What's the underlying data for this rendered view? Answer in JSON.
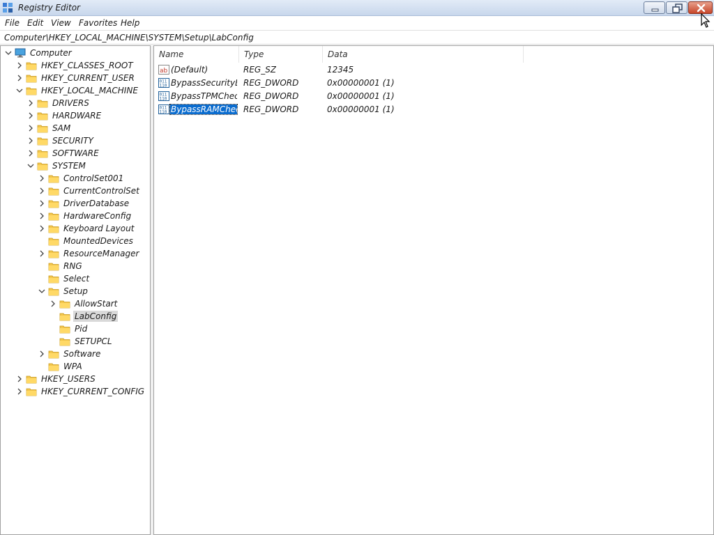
{
  "window": {
    "title": "Registry Editor",
    "app_icon": "registry-editor-icon",
    "controls": [
      "minimize-icon",
      "restore-icon",
      "close-icon"
    ],
    "accent_close": "#c7462a",
    "title_gradient": [
      "#e2ebf7",
      "#c8d7ec"
    ]
  },
  "menu": {
    "items": [
      "File",
      "Edit",
      "View",
      "Favorites",
      "Help"
    ]
  },
  "address": {
    "path": "Computer\\HKEY_LOCAL_MACHINE\\SYSTEM\\Setup\\LabConfig"
  },
  "tree": {
    "nodes": [
      {
        "label": "Computer",
        "depth": 0,
        "expander": "expanded",
        "icon": "computer-icon"
      },
      {
        "label": "HKEY_CLASSES_ROOT",
        "depth": 1,
        "expander": "collapsed",
        "icon": "folder-icon"
      },
      {
        "label": "HKEY_CURRENT_USER",
        "depth": 1,
        "expander": "collapsed",
        "icon": "folder-icon"
      },
      {
        "label": "HKEY_LOCAL_MACHINE",
        "depth": 1,
        "expander": "expanded",
        "icon": "folder-icon"
      },
      {
        "label": "DRIVERS",
        "depth": 2,
        "expander": "collapsed",
        "icon": "folder-icon"
      },
      {
        "label": "HARDWARE",
        "depth": 2,
        "expander": "collapsed",
        "icon": "folder-icon"
      },
      {
        "label": "SAM",
        "depth": 2,
        "expander": "collapsed",
        "icon": "folder-icon"
      },
      {
        "label": "SECURITY",
        "depth": 2,
        "expander": "collapsed",
        "icon": "folder-icon"
      },
      {
        "label": "SOFTWARE",
        "depth": 2,
        "expander": "collapsed",
        "icon": "folder-icon"
      },
      {
        "label": "SYSTEM",
        "depth": 2,
        "expander": "expanded",
        "icon": "folder-icon"
      },
      {
        "label": "ControlSet001",
        "depth": 3,
        "expander": "collapsed",
        "icon": "folder-icon"
      },
      {
        "label": "CurrentControlSet",
        "depth": 3,
        "expander": "collapsed",
        "icon": "folder-icon"
      },
      {
        "label": "DriverDatabase",
        "depth": 3,
        "expander": "collapsed",
        "icon": "folder-icon"
      },
      {
        "label": "HardwareConfig",
        "depth": 3,
        "expander": "collapsed",
        "icon": "folder-icon"
      },
      {
        "label": "Keyboard Layout",
        "depth": 3,
        "expander": "collapsed",
        "icon": "folder-icon"
      },
      {
        "label": "MountedDevices",
        "depth": 3,
        "expander": "none",
        "icon": "folder-icon"
      },
      {
        "label": "ResourceManager",
        "depth": 3,
        "expander": "collapsed",
        "icon": "folder-icon"
      },
      {
        "label": "RNG",
        "depth": 3,
        "expander": "none",
        "icon": "folder-icon"
      },
      {
        "label": "Select",
        "depth": 3,
        "expander": "none",
        "icon": "folder-icon"
      },
      {
        "label": "Setup",
        "depth": 3,
        "expander": "expanded",
        "icon": "folder-icon"
      },
      {
        "label": "AllowStart",
        "depth": 4,
        "expander": "collapsed",
        "icon": "folder-icon"
      },
      {
        "label": "LabConfig",
        "depth": 4,
        "expander": "none",
        "icon": "folder-icon",
        "selected": true
      },
      {
        "label": "Pid",
        "depth": 4,
        "expander": "none",
        "icon": "folder-icon"
      },
      {
        "label": "SETUPCL",
        "depth": 4,
        "expander": "none",
        "icon": "folder-icon"
      },
      {
        "label": "Software",
        "depth": 3,
        "expander": "collapsed",
        "icon": "folder-icon"
      },
      {
        "label": "WPA",
        "depth": 3,
        "expander": "none",
        "icon": "folder-icon"
      },
      {
        "label": "HKEY_USERS",
        "depth": 1,
        "expander": "collapsed",
        "icon": "folder-icon"
      },
      {
        "label": "HKEY_CURRENT_CONFIG",
        "depth": 1,
        "expander": "collapsed",
        "icon": "folder-icon"
      }
    ]
  },
  "values": {
    "columns": [
      "Name",
      "Type",
      "Data"
    ],
    "rows": [
      {
        "name": "(Default)",
        "type": "REG_SZ",
        "data": "12345",
        "icon": "string-value-icon"
      },
      {
        "name": "BypassSecurityB...",
        "type": "REG_DWORD",
        "data": "0x00000001 (1)",
        "icon": "binary-value-icon"
      },
      {
        "name": "BypassTPMCheck",
        "type": "REG_DWORD",
        "data": "0x00000001 (1)",
        "icon": "binary-value-icon"
      },
      {
        "name": "BypassRAMCheck",
        "type": "REG_DWORD",
        "data": "0x00000001 (1)",
        "icon": "binary-value-icon",
        "selected": true
      }
    ],
    "selection_color": "#0a6ccf"
  }
}
